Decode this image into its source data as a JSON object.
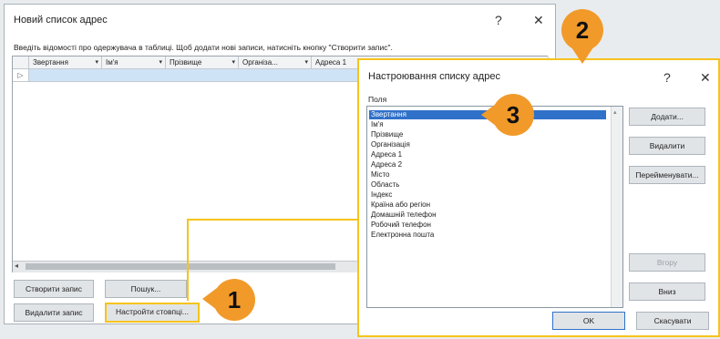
{
  "main_window": {
    "title": "Новий список адрес",
    "help_label": "?",
    "close_label": "✕",
    "instruction": "Введіть відомості про одержувача в таблиці. Щоб додати нові записи, натисніть кнопку \"Створити запис\".",
    "columns": [
      "Звертання",
      "Ім'я",
      "Прізвище",
      "Організа...",
      "Адреса 1"
    ],
    "buttons": {
      "new_entry": "Створити запис",
      "find": "Пошук...",
      "delete_entry": "Видалити запис",
      "customize_columns": "Настройти стовпці..."
    }
  },
  "dialog": {
    "title": "Настроювання списку адрес",
    "help_label": "?",
    "close_label": "✕",
    "fields_label": "Поля",
    "fields": [
      "Звертання",
      "Ім'я",
      "Прізвище",
      "Організація",
      "Адреса 1",
      "Адреса 2",
      "Місто",
      "Область",
      "Індекс",
      "Країна або регіон",
      "Домашній телефон",
      "Робочий телефон",
      "Електронна пошта"
    ],
    "selected_index": 0,
    "buttons": {
      "add": "Додати...",
      "delete": "Видалити",
      "rename": "Перейменувати...",
      "move_up": "Вгору",
      "move_down": "Вниз",
      "ok": "OK",
      "cancel": "Скасувати"
    }
  },
  "callouts": [
    "1",
    "2",
    "3"
  ],
  "accent_colors": {
    "callout": "#f19a2a",
    "highlight": "#f6c31c",
    "selection": "#2f71c9"
  }
}
